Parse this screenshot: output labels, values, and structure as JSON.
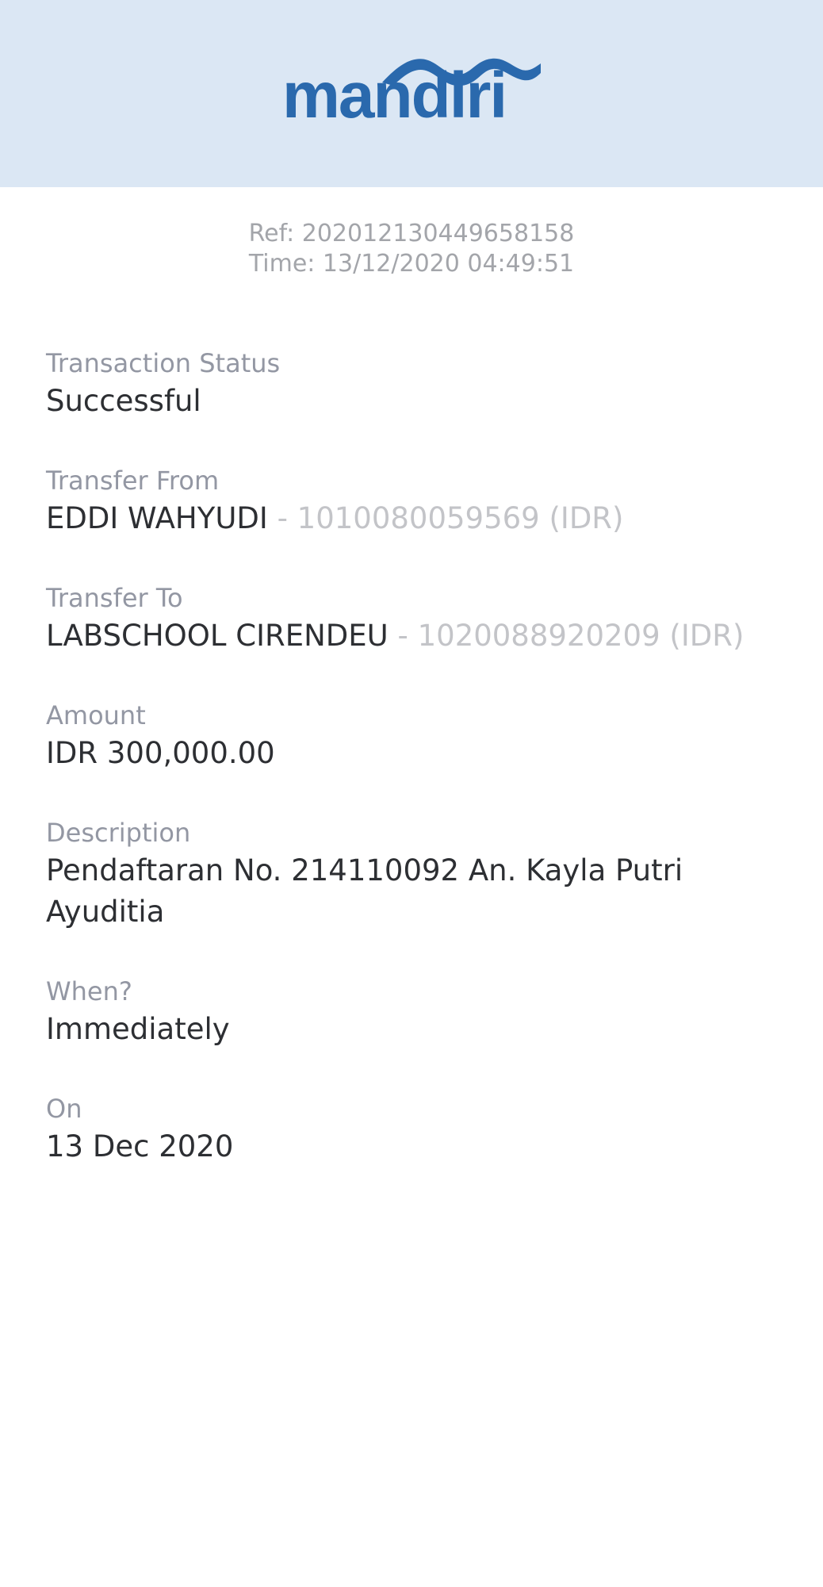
{
  "header": {
    "logo_text": "mandiri",
    "brand_color": "#2a69ad",
    "background_color": "#dbe7f4"
  },
  "receipt": {
    "ref": "Ref: 202012130449658158",
    "time": "Time: 13/12/2020 04:49:51"
  },
  "fields": {
    "status": {
      "label": "Transaction Status",
      "value": "Successful"
    },
    "from": {
      "label": "Transfer From",
      "name": "EDDI WAHYUDI",
      "account": " - 1010080059569 (IDR)"
    },
    "to": {
      "label": "Transfer To",
      "name": "LABSCHOOL CIRENDEU",
      "account": " - 1020088920209 (IDR)"
    },
    "amount": {
      "label": "Amount",
      "value": "IDR 300,000.00"
    },
    "description": {
      "label": "Description",
      "value": "Pendaftaran No. 214110092 An. Kayla Putri Ayuditia"
    },
    "when": {
      "label": "When?",
      "value": "Immediately"
    },
    "on": {
      "label": "On",
      "value": "13 Dec 2020"
    }
  }
}
